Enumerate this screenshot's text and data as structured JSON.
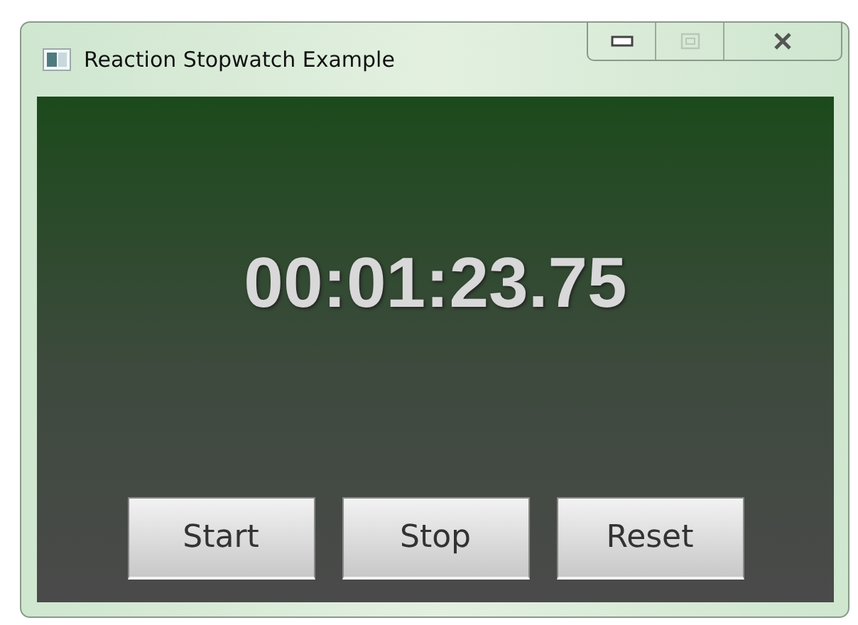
{
  "window": {
    "title": "Reaction Stopwatch Example"
  },
  "display": {
    "time": "00:01:23.75"
  },
  "buttons": [
    {
      "label": "Start"
    },
    {
      "label": "Stop"
    },
    {
      "label": "Reset"
    }
  ]
}
